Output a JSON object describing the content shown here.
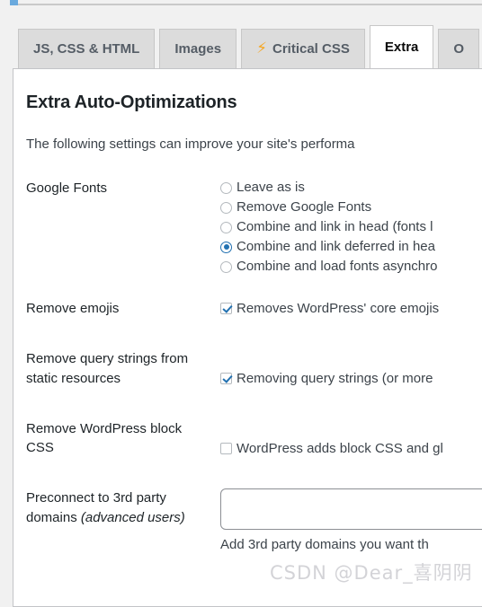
{
  "tabs": [
    {
      "label": "JS, CSS & HTML",
      "active": false,
      "icon": null
    },
    {
      "label": "Images",
      "active": false,
      "icon": null
    },
    {
      "label": "Critical CSS",
      "active": false,
      "icon": "lightning-bolt-icon"
    },
    {
      "label": "Extra",
      "active": true,
      "icon": null
    },
    {
      "label": "O",
      "active": false,
      "icon": null
    }
  ],
  "panel": {
    "title": "Extra Auto-Optimizations",
    "intro": "The following settings can improve your site's performa"
  },
  "settings": {
    "google_fonts": {
      "label": "Google Fonts",
      "options": [
        {
          "label": "Leave as is",
          "checked": false
        },
        {
          "label": "Remove Google Fonts",
          "checked": false
        },
        {
          "label": "Combine and link in head (fonts l",
          "checked": false
        },
        {
          "label": "Combine and link deferred in hea",
          "checked": true
        },
        {
          "label": "Combine and load fonts asynchro",
          "checked": false
        }
      ]
    },
    "remove_emojis": {
      "label": "Remove emojis",
      "checkbox_label": "Removes WordPress' core emojis",
      "checked": true
    },
    "remove_query_strings": {
      "label": "Remove query strings from static resources",
      "checkbox_label": "Removing query strings (or more",
      "checked": true
    },
    "remove_block_css": {
      "label": "Remove WordPress block CSS",
      "checkbox_label": "WordPress adds block CSS and gl",
      "checked": false
    },
    "preconnect": {
      "label_main": "Preconnect to 3rd party domains ",
      "label_italic": "(advanced users)",
      "value": "",
      "placeholder": "",
      "help": "Add 3rd party domains you want th"
    }
  },
  "watermark": {
    "text": "CSDN @Dear_喜阴阴"
  },
  "colors": {
    "accent": "#2271b1",
    "bolt": "#f5a623",
    "tab_inactive_bg": "#dcdcdc",
    "tab_active_bg": "#ffffff",
    "page_bg": "#f1f1f1"
  }
}
